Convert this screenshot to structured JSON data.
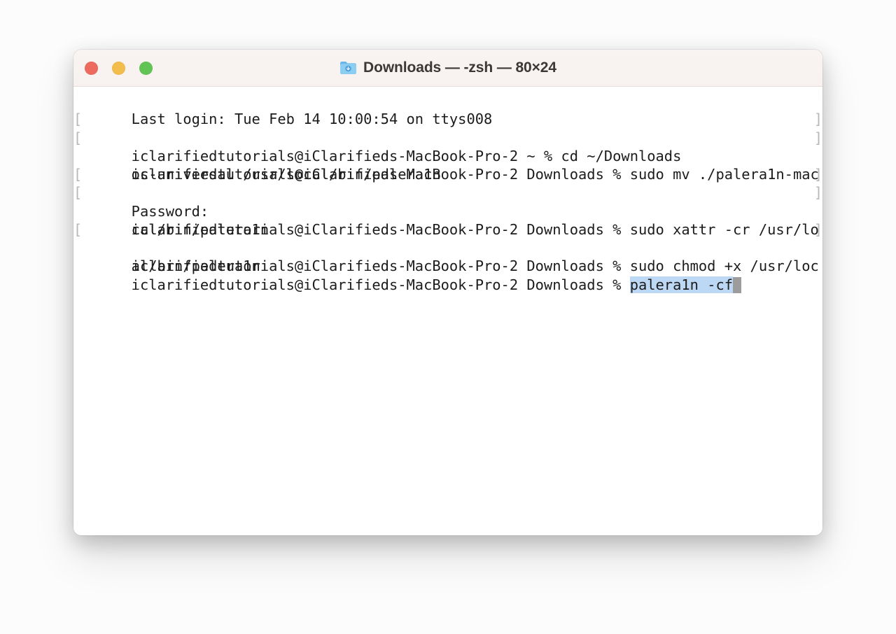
{
  "window": {
    "title": "Downloads — -zsh — 80×24",
    "folder_icon": "downloads-folder-icon",
    "controls": {
      "close": "close-window-button",
      "minimize": "minimize-window-button",
      "maximize": "maximize-window-button"
    }
  },
  "colors": {
    "page_background": "#FCFCFC",
    "titlebar_background": "#F8F2F0",
    "terminal_background": "#FFFFFF",
    "terminal_text": "#1C1C1C",
    "selection_highlight": "#BDD8F4",
    "cursor": "#9C9C9C",
    "traffic_close": "#EC6A5E",
    "traffic_minimize": "#F2BD4C",
    "traffic_maximize": "#61C454",
    "wrap_bracket": "#B8B8B8"
  },
  "terminal": {
    "columns": 80,
    "rows": 24,
    "shell": "-zsh",
    "lines": [
      {
        "bracket": false,
        "text": "Last login: Tue Feb 14 10:00:54 on ttys008"
      },
      {
        "bracket": true,
        "text": "iclarifiedtutorials@iClarifieds-MacBook-Pro-2 ~ % cd ~/Downloads"
      },
      {
        "bracket": true,
        "text": "iclarifiedtutorials@iClarifieds-MacBook-Pro-2 Downloads % sudo mv ./palera1n-mac"
      },
      {
        "bracket": false,
        "text": "os-universal /usr/local/bin/palera1n"
      },
      {
        "bracket": true,
        "text": "Password:"
      },
      {
        "bracket": true,
        "text": "iclarifiedtutorials@iClarifieds-MacBook-Pro-2 Downloads % sudo xattr -cr /usr/lo"
      },
      {
        "bracket": false,
        "text": "cal/bin/palera1n"
      },
      {
        "bracket": true,
        "text": "iclarifiedtutorials@iClarifieds-MacBook-Pro-2 Downloads % sudo chmod +x /usr/loc"
      },
      {
        "bracket": false,
        "text": "al/bin/palera1n"
      }
    ],
    "prompt_line": {
      "prompt": "iclarifiedtutorials@iClarifieds-MacBook-Pro-2 Downloads % ",
      "command": "palera1n -cf",
      "command_selected": true,
      "cursor": "block"
    },
    "bracket_open": "[",
    "bracket_close": "]"
  }
}
